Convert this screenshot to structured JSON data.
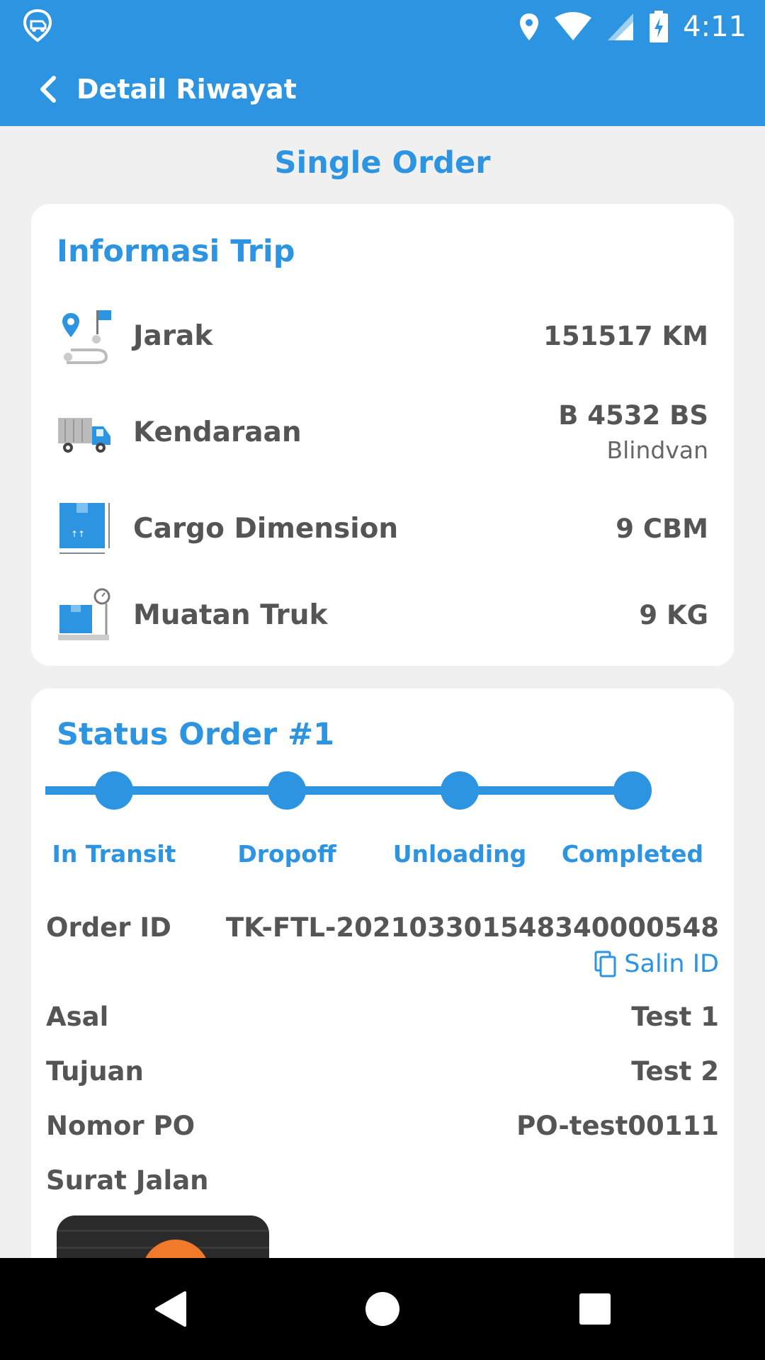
{
  "status_bar": {
    "time": "4:11"
  },
  "header": {
    "title": "Detail Riwayat"
  },
  "page_title": "Single Order",
  "trip_info": {
    "heading": "Informasi Trip",
    "rows": [
      {
        "icon": "route-map-icon",
        "label": "Jarak",
        "value": "151517 KM",
        "sub": ""
      },
      {
        "icon": "truck-icon",
        "label": "Kendaraan",
        "value": "B 4532 BS",
        "sub": "Blindvan"
      },
      {
        "icon": "cargo-box-icon",
        "label": "Cargo Dimension",
        "value": "9 CBM",
        "sub": ""
      },
      {
        "icon": "scale-icon",
        "label": "Muatan Truk",
        "value": "9 KG",
        "sub": ""
      }
    ]
  },
  "order_status": {
    "heading": "Status Order #1",
    "steps": [
      "In Transit",
      "Dropoff",
      "Unloading",
      "Completed"
    ],
    "order_id_label": "Order ID",
    "order_id": "TK-FTL-20210330154834000054​8",
    "copy_label": "Salin ID",
    "origin_label": "Asal",
    "origin": "Test 1",
    "destination_label": "Tujuan",
    "destination": "Test 2",
    "po_label": "Nomor PO",
    "po": "PO-test00111",
    "surat_jalan_label": "Surat Jalan"
  },
  "colors": {
    "primary": "#2c94e0",
    "text": "#555555",
    "background": "#f0f0f0"
  }
}
